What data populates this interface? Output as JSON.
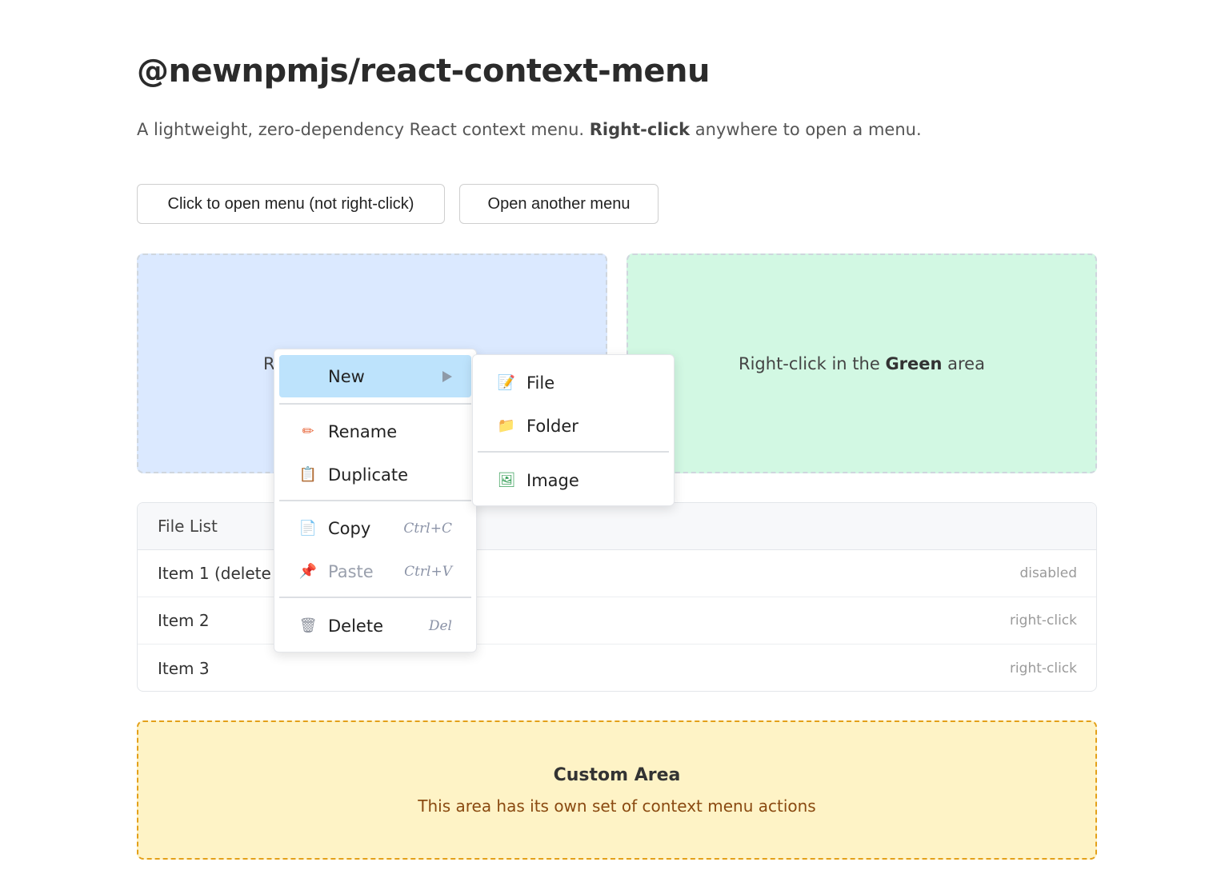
{
  "page": {
    "title": "@newnpmjs/react-context-menu",
    "subtitle_pre": "A lightweight, zero-dependency React context menu. ",
    "subtitle_bold": "Right-click",
    "subtitle_post": " anywhere to open a menu."
  },
  "buttons": {
    "open_menu": "Click to open menu (not right-click)",
    "open_another": "Open another menu"
  },
  "areas": {
    "blue_partial": "R",
    "green_pre": "Right-click in the ",
    "green_bold": "Green",
    "green_post": " area"
  },
  "file_list": {
    "header": "File List",
    "rows": [
      {
        "name": "Item 1 (delete d",
        "hint": "disabled"
      },
      {
        "name": "Item 2",
        "hint": "right-click"
      },
      {
        "name": "Item 3",
        "hint": "right-click"
      }
    ]
  },
  "custom_area": {
    "title": "Custom Area",
    "description": "This area has its own set of context menu actions"
  },
  "context_menu": {
    "items": [
      {
        "label": "New",
        "icon": "new-icon",
        "has_submenu": true,
        "active": true
      },
      {
        "label": "Rename",
        "icon": "pencil-icon",
        "glyph": "✏"
      },
      {
        "label": "Duplicate",
        "icon": "clipboard-icon",
        "glyph": "📋"
      },
      {
        "label": "Copy",
        "icon": "document-icon",
        "glyph": "📄",
        "shortcut": "Ctrl+C"
      },
      {
        "label": "Paste",
        "icon": "pushpin-icon",
        "glyph": "📌",
        "shortcut": "Ctrl+V",
        "disabled": true
      },
      {
        "label": "Delete",
        "icon": "trash-icon",
        "glyph": "🗑",
        "shortcut": "Del"
      }
    ]
  },
  "submenu": {
    "items": [
      {
        "label": "File",
        "icon": "file-edit-icon",
        "glyph": "📝"
      },
      {
        "label": "Folder",
        "icon": "folder-icon",
        "glyph": "📁"
      },
      {
        "label": "Image",
        "icon": "picture-icon",
        "glyph": "🖼"
      }
    ]
  },
  "colors": {
    "active_item_bg": "#bde3fc",
    "blue_area_bg": "#dbe9ff",
    "green_area_bg": "#d2f8e3",
    "custom_area_bg": "#fef3c6",
    "custom_area_border": "#e3a019"
  }
}
